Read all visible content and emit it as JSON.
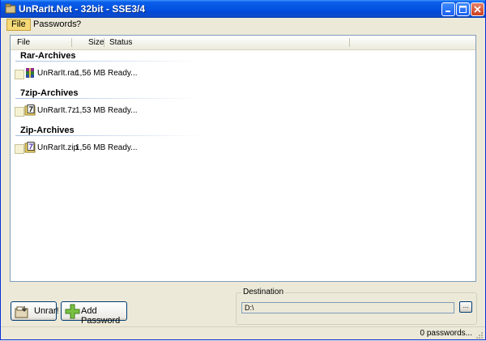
{
  "window": {
    "title": "UnRarIt.Net - 32bit - SSE3/4"
  },
  "menu": {
    "items": [
      "File",
      "Passwords",
      "?"
    ]
  },
  "list": {
    "columns": [
      "File",
      "Size",
      "Status"
    ],
    "groups": [
      {
        "title": "Rar-Archives",
        "file": "UnRarIt.rar",
        "size": "1,56 MB",
        "status": "Ready..."
      },
      {
        "title": "7zip-Archives",
        "file": "UnRarIt.7z",
        "size": "1,53 MB",
        "status": "Ready..."
      },
      {
        "title": "Zip-Archives",
        "file": "UnRarIt.zip",
        "size": "1,56 MB",
        "status": "Ready..."
      }
    ]
  },
  "buttons": {
    "unrar": "Unrar!",
    "add_password": "Add Password",
    "browse": "..."
  },
  "destination": {
    "label": "Destination",
    "value": "D:\\"
  },
  "status": {
    "text": "0 passwords..."
  },
  "colors": {
    "titlebar": "#0554e3",
    "window_bg": "#ece9d8",
    "list_border": "#7f9db9",
    "menu_highlight": "#f6d977"
  }
}
